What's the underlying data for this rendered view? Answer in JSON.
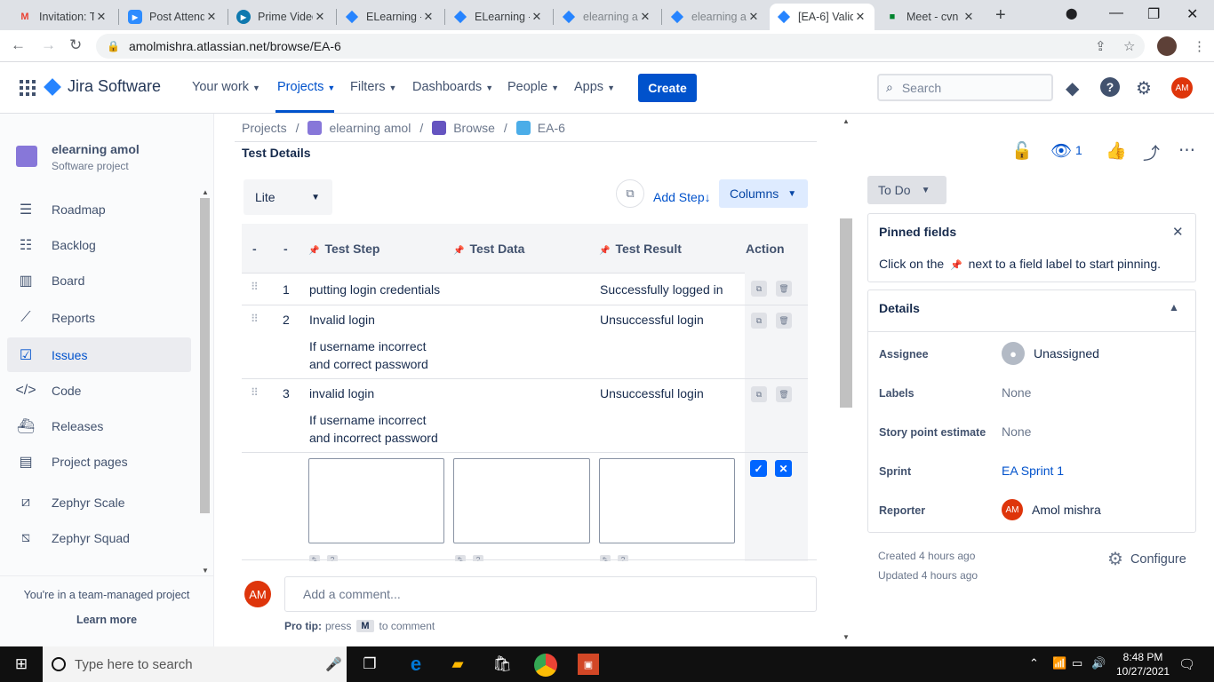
{
  "browser": {
    "tabs": [
      {
        "title": "Invitation: T",
        "icon": "gmail-icon",
        "color": "#ea4335"
      },
      {
        "title": "Post Attend",
        "icon": "zoom-icon",
        "color": "#2d8cff"
      },
      {
        "title": "Prime Video",
        "icon": "prime-icon",
        "color": "#00a8e1"
      },
      {
        "title": "ELearning -",
        "icon": "jira-icon",
        "color": "#2684ff"
      },
      {
        "title": "ELearning -",
        "icon": "jira-icon",
        "color": "#2684ff"
      },
      {
        "title": "elearning a",
        "icon": "jira-icon",
        "color": "#2684ff"
      },
      {
        "title": "elearning a",
        "icon": "jira-icon",
        "color": "#2684ff"
      },
      {
        "title": "[EA-6] Valid",
        "icon": "jira-icon",
        "color": "#2684ff"
      },
      {
        "title": "Meet - cvn",
        "icon": "meet-icon",
        "color": "#00832d"
      }
    ],
    "url": "amolmishra.atlassian.net/browse/EA-6"
  },
  "topnav": {
    "product": "Jira Software",
    "items": [
      {
        "label": "Your work"
      },
      {
        "label": "Projects"
      },
      {
        "label": "Filters"
      },
      {
        "label": "Dashboards"
      },
      {
        "label": "People"
      },
      {
        "label": "Apps"
      }
    ],
    "create": "Create",
    "search_placeholder": "Search",
    "avatar": "AM"
  },
  "sidebar": {
    "project_name": "elearning amol",
    "project_type": "Software project",
    "items": [
      {
        "label": "Roadmap",
        "icon": "roadmap-icon"
      },
      {
        "label": "Backlog",
        "icon": "backlog-icon"
      },
      {
        "label": "Board",
        "icon": "board-icon"
      },
      {
        "label": "Reports",
        "icon": "reports-icon"
      },
      {
        "label": "Issues",
        "icon": "issues-icon"
      },
      {
        "label": "Code",
        "icon": "code-icon"
      },
      {
        "label": "Releases",
        "icon": "releases-icon"
      },
      {
        "label": "Project pages",
        "icon": "pages-icon"
      },
      {
        "label": "Zephyr Scale",
        "icon": "zephyr-scale-icon"
      },
      {
        "label": "Zephyr Squad",
        "icon": "zephyr-squad-icon"
      }
    ],
    "footer_text": "You're in a team-managed project",
    "learn_more": "Learn more"
  },
  "main": {
    "breadcrumbs": [
      "Projects",
      "elearning amol",
      "Browse",
      "EA-6"
    ],
    "section_title": "Test Details",
    "view_select": "Lite",
    "add_step": "Add Step",
    "add_step_arrow": "↓",
    "columns": "Columns",
    "table": {
      "headers": [
        "-",
        "-",
        "Test Step",
        "Test Data",
        "Test Result",
        "Action"
      ],
      "rows": [
        {
          "num": "1",
          "step": "putting login credentials",
          "step_note": "",
          "step_note2": "",
          "data": "",
          "result": "Successfully logged in"
        },
        {
          "num": "2",
          "step": "Invalid login",
          "step_note": "If username incorrect",
          "step_note2": "and correct password",
          "data": "",
          "result": "Unsuccessful login"
        },
        {
          "num": "3",
          "step": "invalid login",
          "step_note": "If username incorrect",
          "step_note2": "and incorrect password",
          "data": "",
          "result": "Unsuccessful login"
        }
      ]
    },
    "comment_avatar": "AM",
    "comment_placeholder": "Add a comment...",
    "protip_label": "Pro tip:",
    "protip_pre": "press",
    "protip_key": "M",
    "protip_post": "to comment"
  },
  "right": {
    "watch_count": "1",
    "status": "To Do",
    "pinned_title": "Pinned fields",
    "pinned_text_pre": "Click on the",
    "pinned_text_post": "next to a field label to start pinning.",
    "details_title": "Details",
    "fields": [
      {
        "label": "Assignee",
        "value": "Unassigned"
      },
      {
        "label": "Labels",
        "value": "None"
      },
      {
        "label": "Story point estimate",
        "value": "None"
      },
      {
        "label": "Sprint",
        "value": "EA Sprint 1"
      },
      {
        "label": "Reporter",
        "value": "Amol mishra"
      }
    ],
    "reporter_avatar": "AM",
    "created": "Created 4 hours ago",
    "updated": "Updated 4 hours ago",
    "configure": "Configure"
  },
  "taskbar": {
    "search_placeholder": "Type here to search",
    "time": "8:48 PM",
    "date": "10/27/2021"
  }
}
